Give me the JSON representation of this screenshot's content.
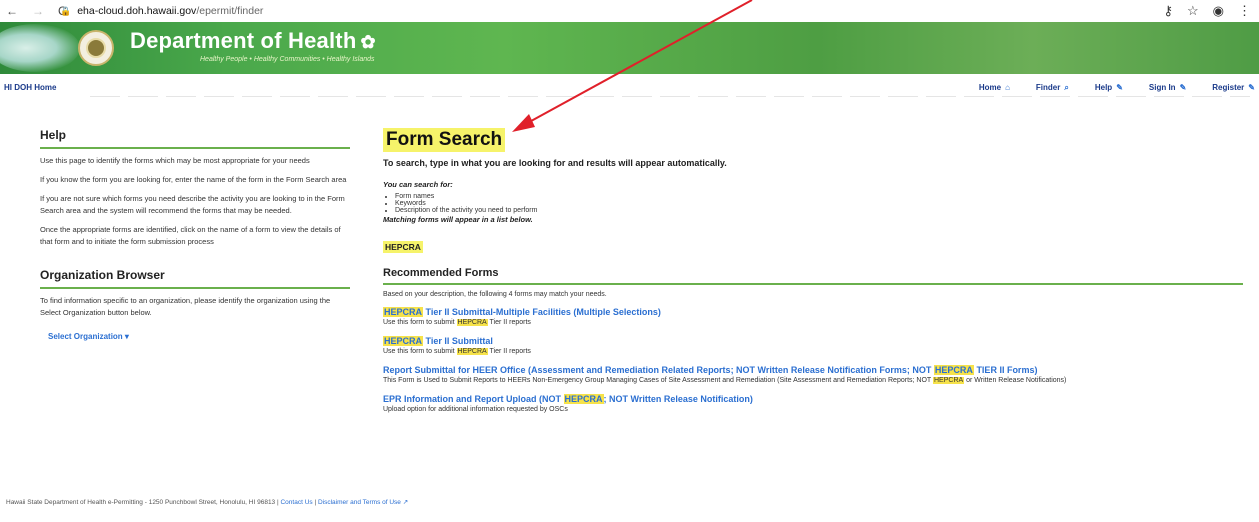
{
  "browser": {
    "back_icon": "back-arrow-icon",
    "forward_icon": "forward-arrow-icon",
    "reload_icon": "reload-icon",
    "host": "eha-cloud.doh.hawaii.gov",
    "path": "/epermit/finder"
  },
  "banner": {
    "title": "Department of Health",
    "tagline": "Healthy People • Healthy Communities • Healthy Islands"
  },
  "topnav": {
    "home_label": "HI DOH Home",
    "links": [
      {
        "label": "Home",
        "icon": "house-icon"
      },
      {
        "label": "Finder",
        "icon": "search-icon"
      },
      {
        "label": "Help",
        "icon": "pencil-icon"
      },
      {
        "label": "Sign In",
        "icon": "pencil-icon"
      },
      {
        "label": "Register",
        "icon": "pencil-icon"
      }
    ]
  },
  "help": {
    "heading": "Help",
    "paragraphs": [
      "Use this page to identify the forms which may be most appropriate for your needs",
      "If you know the form you are looking for, enter the name of the form in the Form Search area",
      "If you are not sure which forms you need describe the activity you are looking to in the Form Search area and the system will recommend the forms that may be needed.",
      "Once the appropriate forms are identified, click on the name of a form to view the details of that form and to initiate the form submission process"
    ]
  },
  "org_browser": {
    "heading": "Organization Browser",
    "text": "To find information specific to an organization, please identify the organization using the Select Organization button below.",
    "select_label": "Select Organization"
  },
  "form_search": {
    "heading": "Form Search",
    "lead": "To search, type in what you are looking for and results will appear automatically.",
    "can_search": "You can search for:",
    "bullets": [
      "Form names",
      "Keywords",
      "Description of the activity you need to perform"
    ],
    "matching": "Matching forms will appear in a list below.",
    "query": "HEPCRA"
  },
  "recommended": {
    "heading": "Recommended Forms",
    "based_on": "Based on your description, the following 4 forms may match your needs.",
    "items": [
      {
        "title_pre": "",
        "title_hl": "HEPCRA",
        "title_post": " Tier II Submittal-Multiple Facilities (Multiple Selections)",
        "desc_pre": "Use this form to submit ",
        "desc_hl": "HEPCRA",
        "desc_post": " Tier II reports"
      },
      {
        "title_pre": "",
        "title_hl": "HEPCRA",
        "title_post": " Tier II Submittal",
        "desc_pre": "Use this form to submit ",
        "desc_hl": "HEPCRA",
        "desc_post": " Tier II reports"
      },
      {
        "title_pre": "Report Submittal for HEER Office (Assessment and Remediation Related Reports; NOT Written Release Notification Forms; NOT ",
        "title_hl": "HEPCRA",
        "title_post": " TIER II Forms)",
        "desc_pre": "This Form is Used to Submit Reports to HEERs Non-Emergency Group Managing Cases of Site Assessment and Remediation (Site Assessment and Remediation Reports; NOT ",
        "desc_hl": "HEPCRA",
        "desc_post": " or Written Release Notifications)"
      },
      {
        "title_pre": "EPR Information and Report Upload (NOT ",
        "title_hl": "HEPCRA",
        "title_post": "; NOT Written Release Notification)",
        "desc_pre": "Upload option for additional information requested by OSCs",
        "desc_hl": "",
        "desc_post": ""
      }
    ]
  },
  "footer": {
    "text": "Hawaii State Department of Health e-Permitting - 1250 Punchbowl Street, Honolulu, HI 96813  |",
    "contact": "Contact Us",
    "disclaimer": "Disclaimer and Terms of Use"
  },
  "colors": {
    "highlight": "#f6f36a",
    "link": "#2b6fd1",
    "accent_green": "#6ab04c",
    "annotation_arrow": "#e0202a"
  }
}
